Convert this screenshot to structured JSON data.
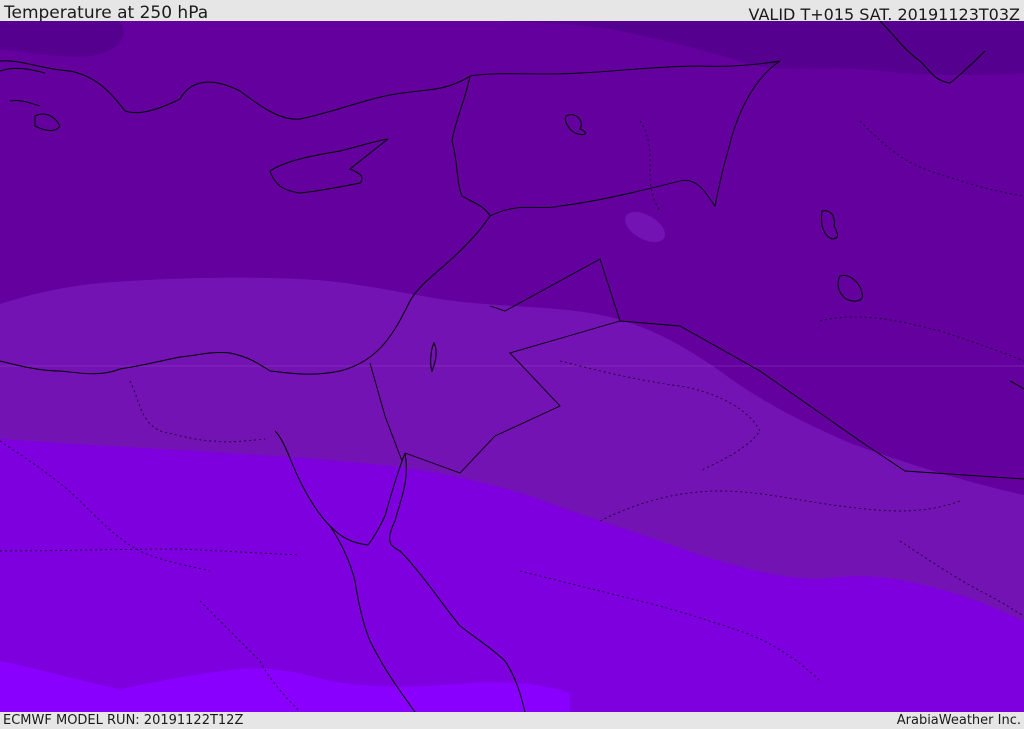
{
  "header": {
    "title": "Temperature at 250 hPa",
    "valid": "VALID T+015 SAT. 20191123T03Z"
  },
  "footer": {
    "model_run": "ECMWF MODEL RUN: 20191122T12Z",
    "credit": "ArabiaWeather Inc."
  },
  "colors": {
    "band_darkest": "#55008f",
    "band_dark": "#63009e",
    "band_mid": "#7413b3",
    "band_bright": "#7e00de",
    "band_brightest": "#8a00ff",
    "coastline": "#000000",
    "border_dotted": "#1a0030",
    "bar_background": "#e6e6e6"
  }
}
